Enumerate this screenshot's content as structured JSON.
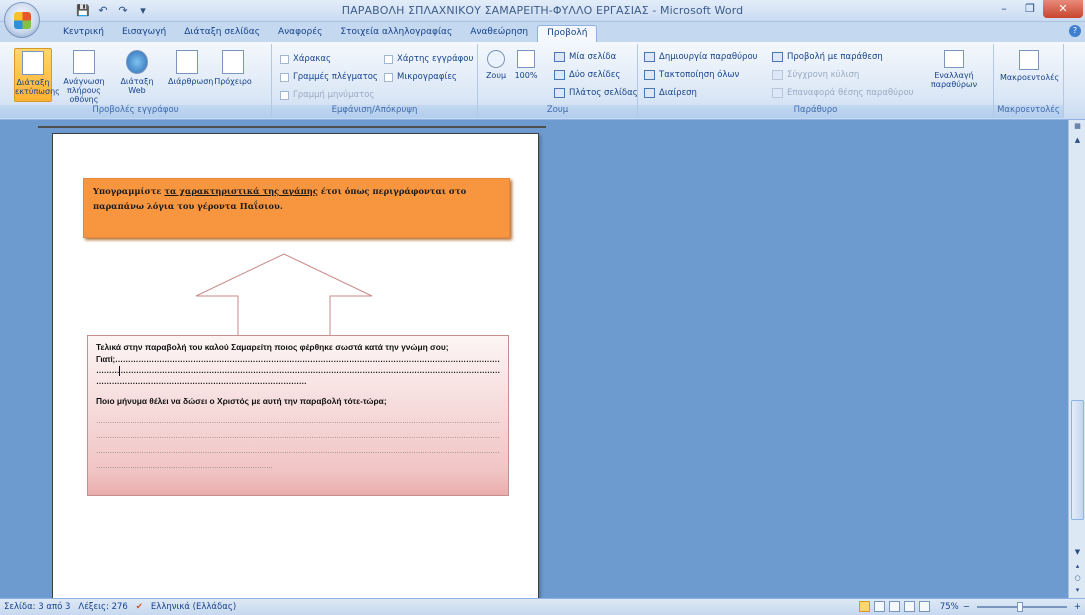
{
  "window": {
    "title": "ΠΑΡΑΒΟΛΗ ΣΠΛΑΧΝΙΚΟΥ ΣΑΜΑΡΕΙΤΗ-ΦΥΛΛΟ ΕΡΓΑΣΙΑΣ - Microsoft Word",
    "minimize": "–",
    "maximize": "❐",
    "close": "✕"
  },
  "qat": {
    "save": "💾",
    "undo": "↶",
    "redo": "↷",
    "more": "▾"
  },
  "tabs": [
    {
      "label": "Κεντρική"
    },
    {
      "label": "Εισαγωγή"
    },
    {
      "label": "Διάταξη σελίδας"
    },
    {
      "label": "Αναφορές"
    },
    {
      "label": "Στοιχεία αλληλογραφίας"
    },
    {
      "label": "Αναθεώρηση"
    },
    {
      "label": "Προβολή"
    }
  ],
  "ribbon": {
    "views": {
      "label": "Προβολές εγγράφου",
      "print_layout": "Διάταξη εκτύπωσης",
      "full_screen": "Ανάγνωση πλήρους οθόνης",
      "web": "Διάταξη Web",
      "outline": "Διάρθρωση",
      "draft": "Πρόχειρο"
    },
    "show_hide": {
      "label": "Εμφάνιση/Απόκρυψη",
      "ruler": "Χάρακας",
      "gridlines": "Γραμμές πλέγματος",
      "message_bar": "Γραμμή μηνύματος",
      "doc_map": "Χάρτης εγγράφου",
      "thumbnails": "Μικρογραφίες"
    },
    "zoom": {
      "label": "Ζουμ",
      "zoom": "Ζουμ",
      "hundred": "100%",
      "one_page": "Μία σελίδα",
      "two_pages": "Δύο σελίδες",
      "page_width": "Πλάτος σελίδας"
    },
    "window": {
      "label": "Παράθυρο",
      "new_window": "Δημιουργία παραθύρου",
      "arrange_all": "Τακτοποίηση όλων",
      "split": "Διαίρεση",
      "side_by_side": "Προβολή με παράθεση",
      "sync_scroll": "Σύγχρονη κύλιση",
      "reset_pos": "Επαναφορά θέσης παραθύρου",
      "switch": "Εναλλαγή παραθύρων"
    },
    "macros": {
      "label": "Μακροεντολές",
      "macros": "Μακροεντολές"
    }
  },
  "document": {
    "box1_a": "Υπογραμμίστε ",
    "box1_ul": "τα χαρακτηριστικά της αγάπης",
    "box1_b": " έτσι όπως περιγράφονται στο παραπάνω λόγια του γέροντα Παΐσιου.",
    "q1": "Τελικά στην παραβολή του καλού Σαμαρείτη ποιος φέρθηκε σωστά κατά την γνώμη σου;",
    "q1_line1": "Γιατί;……………………………………………………………………………………………………………………………………",
    "q1_line2a": "………",
    "q1_line2b": "……………………………………………………………………………………………………………………………………",
    "q1_line3": "………………………………………………………………………",
    "q2": "Ποιο μήνυμα θέλει να δώσει ο Χριστός με αυτή την παραβολή τότε-τώρα;",
    "q2_line1": "……………………………………………………………………………………………………………………………………………………………………",
    "q2_line2": "……………………………………………………………………………………………………………………………………………………………………",
    "q2_line3": "……………………………………………………………………………………………………………………………………………………………………",
    "q2_line4": "……………………………………………………………………"
  },
  "status": {
    "page": "Σελίδα: 3 από 3",
    "words": "Λέξεις: 276",
    "language": "Ελληνικά (Ελλάδας)",
    "zoom": "75%",
    "zoom_out": "−",
    "zoom_in": "+"
  }
}
